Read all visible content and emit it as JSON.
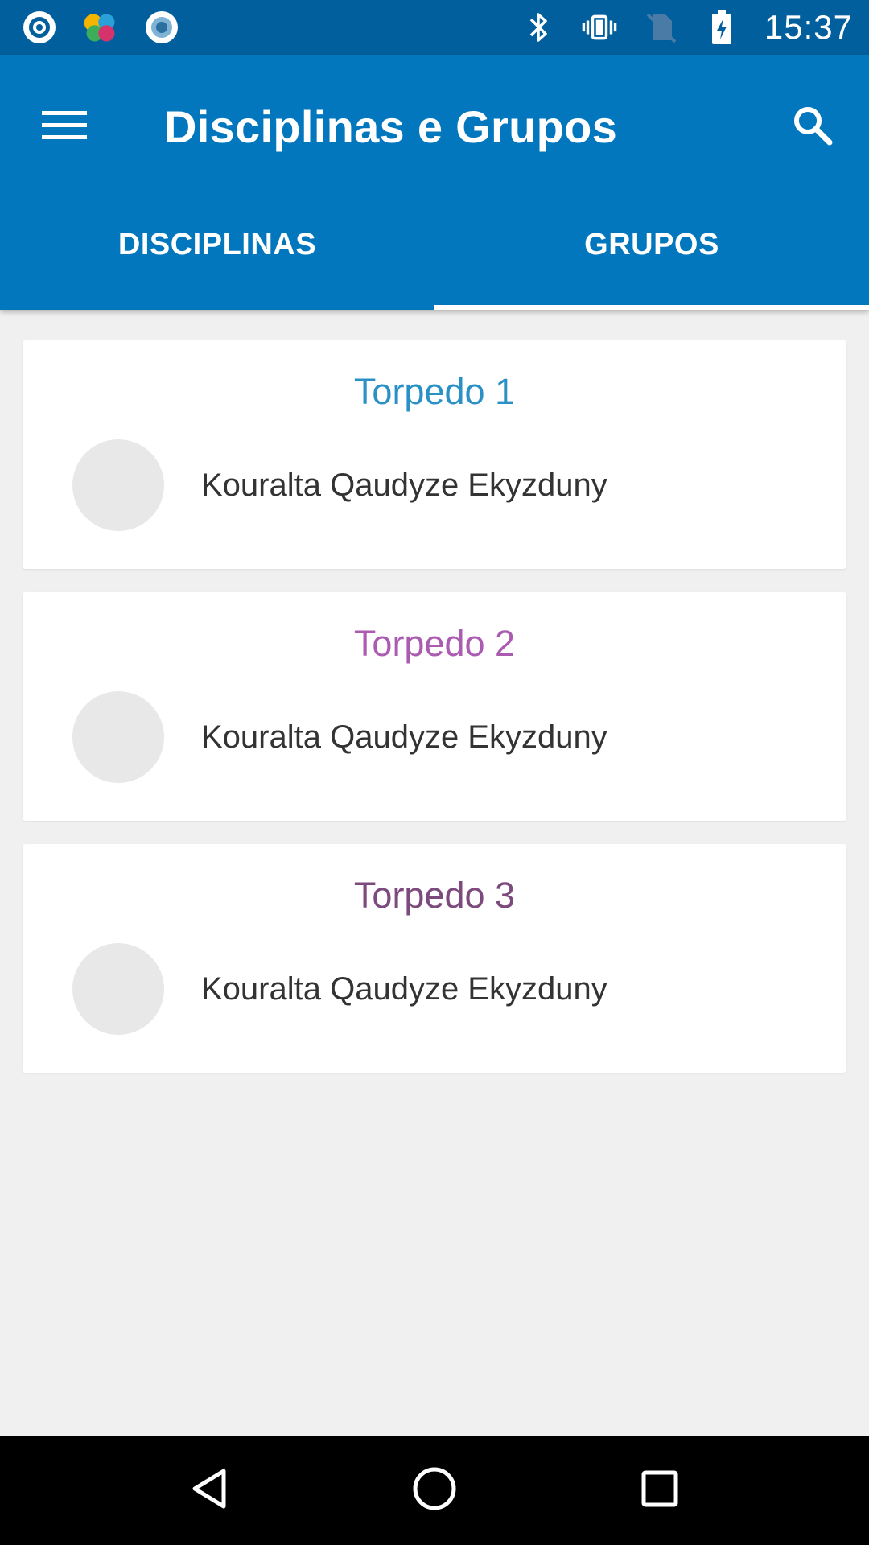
{
  "status_bar": {
    "time": "15:37",
    "icons": [
      "target-app-icon",
      "puzzle-app-icon",
      "record-app-icon",
      "bluetooth-icon",
      "vibrate-icon",
      "no-sim-icon",
      "battery-charging-icon"
    ]
  },
  "app_bar": {
    "title": "Disciplinas e Grupos",
    "menu_icon": "hamburger-menu-icon",
    "search_icon": "search-icon",
    "background_color": "#0277bd"
  },
  "tabs": [
    {
      "label": "DISCIPLINAS",
      "selected": false
    },
    {
      "label": "GRUPOS",
      "selected": true
    }
  ],
  "groups": [
    {
      "title": "Torpedo 1",
      "title_color": "#2a91c7",
      "members": [
        {
          "name": "Kouralta Qaudyze Ekyzduny"
        }
      ]
    },
    {
      "title": "Torpedo 2",
      "title_color": "#ab5cb0",
      "members": [
        {
          "name": "Kouralta Qaudyze Ekyzduny"
        }
      ]
    },
    {
      "title": "Torpedo 3",
      "title_color": "#7d4a7e",
      "members": [
        {
          "name": "Kouralta Qaudyze Ekyzduny"
        }
      ]
    }
  ],
  "nav_bar": {
    "icons": [
      "back-icon",
      "home-icon",
      "recents-icon"
    ]
  }
}
